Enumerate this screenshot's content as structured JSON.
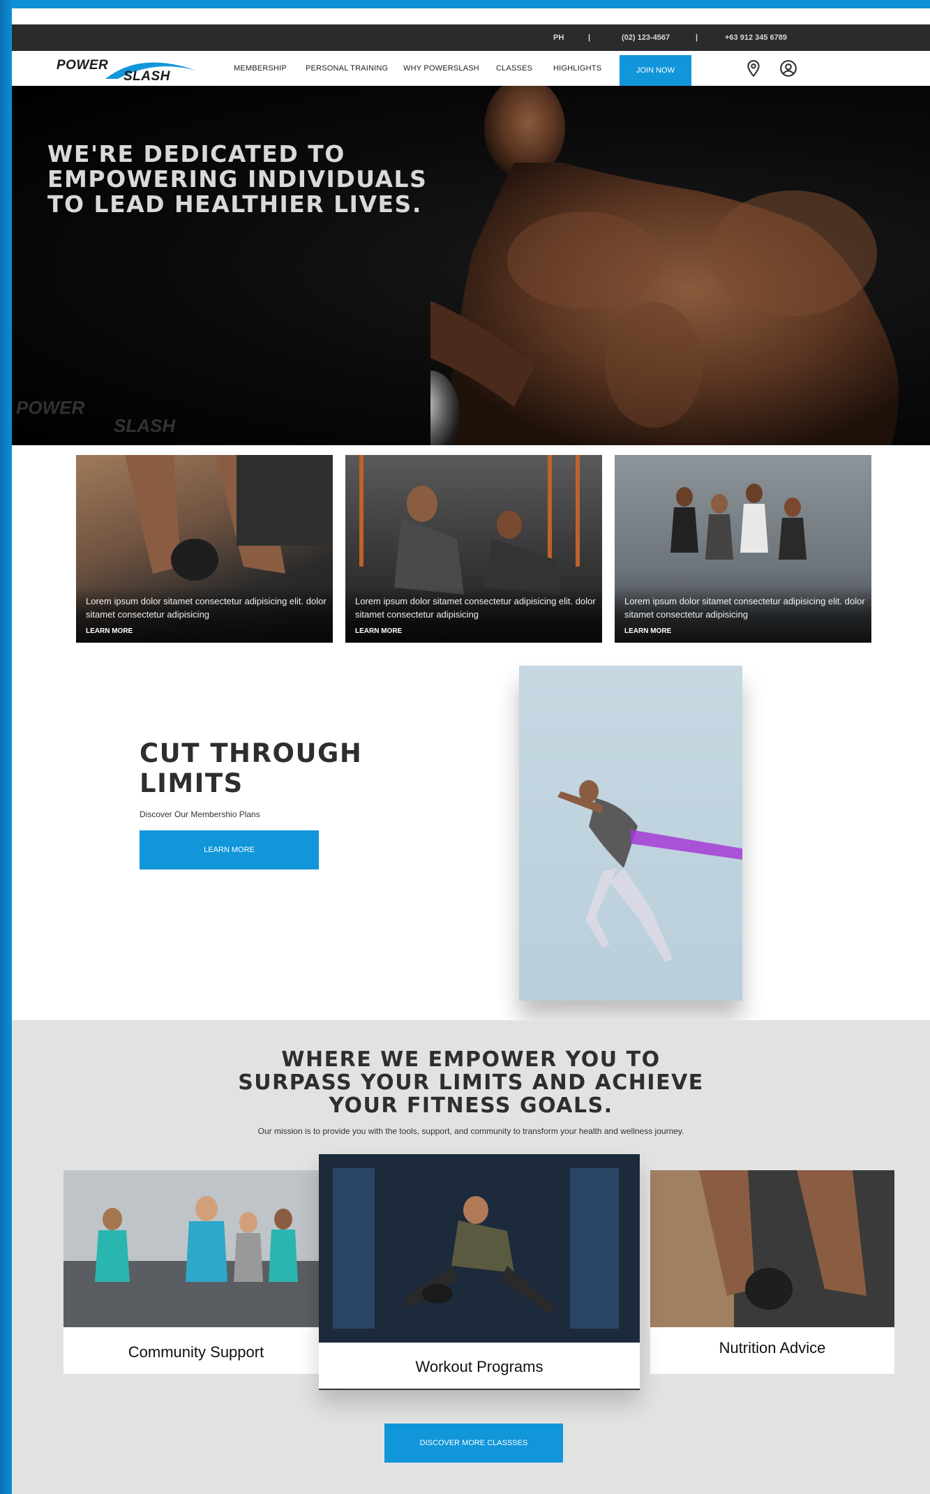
{
  "topbar": {
    "region": "PH",
    "sep1": "|",
    "phone1": "(02) 123-4567",
    "sep2": "|",
    "phone2": "+63 912 345 6789"
  },
  "brand": {
    "word1": "POWER",
    "word2": "SLASH"
  },
  "nav": {
    "items": [
      "MEMBERSHIP",
      "PERSONAL TRAINING",
      "WHY POWERSLASH",
      "CLASSES",
      "HIGHLIGHTS"
    ],
    "join_label": "JOIN NOW",
    "icons": [
      "location-pin-icon",
      "user-account-icon"
    ]
  },
  "hero": {
    "title": "WE'RE DEDICATED TO EMPOWERING INDIVIDUALS TO LEAD HEALTHIER LIVES.",
    "watermark1": "POWER",
    "watermark2": "SLASH"
  },
  "feature_cards": [
    {
      "text": "Lorem ipsum dolor sitamet consectetur adipisicing elit. dolor sitamet consectetur adipisicing",
      "link": "LEARN MORE"
    },
    {
      "text": "Lorem ipsum dolor sitamet consectetur adipisicing elit. dolor sitamet consectetur adipisicing",
      "link": "LEARN MORE"
    },
    {
      "text": "Lorem ipsum dolor sitamet consectetur adipisicing elit. dolor sitamet consectetur adipisicing",
      "link": "LEARN MORE"
    }
  ],
  "cut": {
    "title": "CUT THROUGH LIMITS",
    "subtitle": "Discover Our Membershio Plans",
    "button": "LEARN MORE"
  },
  "mission": {
    "title": "WHERE WE EMPOWER YOU TO SURPASS YOUR LIMITS AND ACHIEVE YOUR FITNESS GOALS.",
    "subtitle": "Our mission is to provide you with the tools, support, and community to transform your health and wellness journey.",
    "tiles": [
      "Community Support",
      "Workout Programs",
      "Nutrition Advice"
    ],
    "button": "DISCOVER MORE CLASSSES"
  },
  "colors": {
    "accent": "#1196d9",
    "dark": "#2b2b2b",
    "section_bg": "#e2e2e2"
  }
}
